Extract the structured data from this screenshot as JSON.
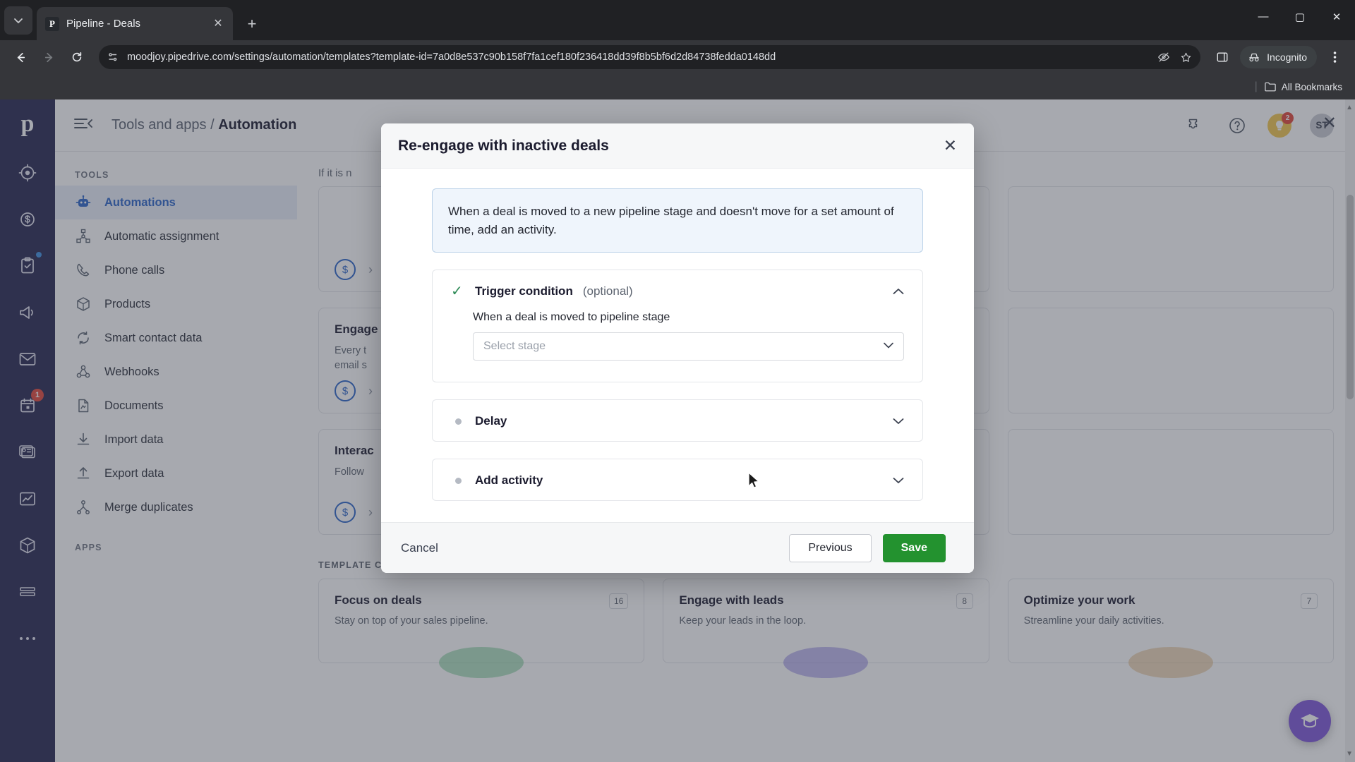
{
  "browser": {
    "tab": {
      "title": "Pipeline - Deals",
      "favicon_letter": "P"
    },
    "new_tab_label": "+",
    "window_controls": {
      "minimize": "—",
      "maximize": "▢",
      "close": "✕"
    },
    "url": "moodjoy.pipedrive.com/settings/automation/templates?template-id=7a0d8e537c90b158f7fa1cef180f236418dd39f8b5bf6d2d84738fedda0148dd",
    "profile_label": "Incognito",
    "bookmarks_label": "All Bookmarks"
  },
  "app": {
    "logo": "p",
    "breadcrumb_parent": "Tools and apps",
    "breadcrumb_sep": "/",
    "breadcrumb_current": "Automations",
    "avatar_initials": "ST",
    "notification_count": "2",
    "sidebar": {
      "section_tools": "TOOLS",
      "section_apps": "APPS",
      "items": [
        {
          "label": "Automations",
          "icon": "robot-icon",
          "active": true
        },
        {
          "label": "Automatic assignment",
          "icon": "assignment-icon",
          "active": false
        },
        {
          "label": "Phone calls",
          "icon": "phone-icon",
          "active": false
        },
        {
          "label": "Products",
          "icon": "box-icon",
          "active": false
        },
        {
          "label": "Smart contact data",
          "icon": "sync-icon",
          "active": false
        },
        {
          "label": "Webhooks",
          "icon": "webhook-icon",
          "active": false
        },
        {
          "label": "Documents",
          "icon": "document-icon",
          "active": false
        },
        {
          "label": "Import data",
          "icon": "import-icon",
          "active": false
        },
        {
          "label": "Export data",
          "icon": "export-icon",
          "active": false
        },
        {
          "label": "Merge duplicates",
          "icon": "merge-icon",
          "active": false
        }
      ]
    },
    "rail_badge_calendar": "1",
    "content": {
      "hint_text": "If it is n",
      "cards": [
        {
          "title": "Engage",
          "body_line1": "Every t",
          "body_line2": "email s"
        },
        {
          "title": "Interac",
          "body_line1": "Follow",
          "body_line2": ""
        }
      ],
      "collections_title": "TEMPLATE COLLECTIONS",
      "collections": [
        {
          "title": "Focus on deals",
          "count": "16",
          "desc": "Stay on top of your sales pipeline.",
          "color": "#6ec98a"
        },
        {
          "title": "Engage with leads",
          "count": "8",
          "desc": "Keep your leads in the loop.",
          "color": "#8b7ee0"
        },
        {
          "title": "Optimize your work",
          "count": "7",
          "desc": "Streamline your daily activities.",
          "color": "#e0b87e"
        }
      ]
    }
  },
  "modal": {
    "title": "Re-engage with inactive deals",
    "close_label": "✕",
    "summary": "When a deal is moved to a new pipeline stage and doesn't move for a set amount of time, add an activity.",
    "steps": [
      {
        "title": "Trigger condition",
        "optional_suffix": "(optional)",
        "state": "complete",
        "expanded": true,
        "field_label": "When a deal is moved to pipeline stage",
        "select_placeholder": "Select stage"
      },
      {
        "title": "Delay",
        "optional_suffix": "",
        "state": "pending",
        "expanded": false
      },
      {
        "title": "Add activity",
        "optional_suffix": "",
        "state": "pending",
        "expanded": false
      }
    ],
    "footer": {
      "cancel_label": "Cancel",
      "previous_label": "Previous",
      "save_label": "Save"
    }
  },
  "colors": {
    "accent_blue": "#2a64c8",
    "save_green": "#23922f",
    "brand_navy": "#26264f",
    "summary_bg": "#eff5fc"
  }
}
